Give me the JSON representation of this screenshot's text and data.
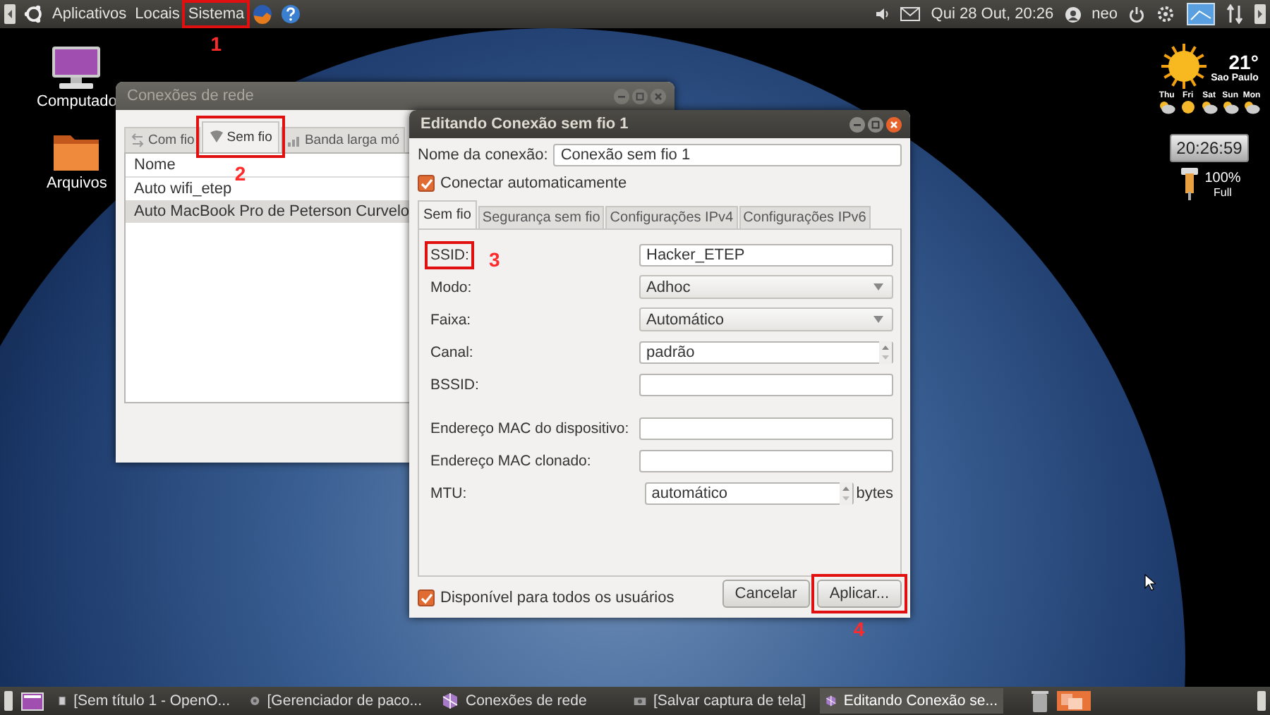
{
  "top_panel": {
    "menus": [
      {
        "label": "Aplicativos"
      },
      {
        "label": "Locais"
      },
      {
        "label": "Sistema"
      }
    ],
    "clock": "Qui 28 Out, 20:26",
    "user": "neo"
  },
  "desktop_icons": [
    {
      "kind": "computer",
      "label": "Computado"
    },
    {
      "kind": "folder",
      "label": "Arquivos"
    }
  ],
  "weather_widget": {
    "temperature": "21°",
    "city": "Sao Paulo",
    "days": [
      "Thu",
      "Fri",
      "Sat",
      "Sun",
      "Mon"
    ],
    "clock": "20:26:59",
    "battery": "100%",
    "battery_state": "Full"
  },
  "network_window": {
    "title": "Conexões de rede",
    "tabs": [
      {
        "label": "Com fio",
        "selected": false
      },
      {
        "label": "Sem fio",
        "selected": true
      },
      {
        "label": "Banda larga mó",
        "selected": false
      }
    ],
    "column": "Nome",
    "rows": [
      {
        "name": "Auto wifi_etep",
        "selected": false
      },
      {
        "name": "Auto MacBook Pro de Peterson Curvelo",
        "selected": true
      }
    ]
  },
  "edit_dialog": {
    "title": "Editando Conexão sem fio 1",
    "name_label": "Nome da conexão:",
    "name_value": "Conexão sem fio 1",
    "auto_connect": {
      "label": "Conectar automaticamente",
      "checked": true
    },
    "tabs": [
      {
        "label": "Sem fio",
        "selected": true
      },
      {
        "label": "Segurança sem fio",
        "selected": false
      },
      {
        "label": "Configurações IPv4",
        "selected": false
      },
      {
        "label": "Configurações IPv6",
        "selected": false
      }
    ],
    "fields": [
      {
        "label": "SSID:",
        "kind": "text",
        "value": "Hacker_ETEP"
      },
      {
        "label": "Modo:",
        "kind": "combo",
        "value": "Adhoc"
      },
      {
        "label": "Faixa:",
        "kind": "combo",
        "value": "Automático"
      },
      {
        "label": "Canal:",
        "kind": "spin",
        "value": "padrão"
      },
      {
        "label": "BSSID:",
        "kind": "text"
      },
      {
        "label": "Endereço MAC do dispositivo:",
        "kind": "text",
        "gap_before": true
      },
      {
        "label": "Endereço MAC clonado:",
        "kind": "text"
      },
      {
        "label": "MTU:",
        "kind": "spin",
        "value": "automático",
        "unit": "bytes"
      }
    ],
    "all_users": {
      "label": "Disponível para todos os usuários",
      "checked": true
    },
    "buttons": [
      {
        "label": "Cancelar"
      },
      {
        "label": "Aplicar..."
      }
    ]
  },
  "annotations": [
    {
      "label": "1"
    },
    {
      "label": "2"
    },
    {
      "label": "3"
    },
    {
      "label": "4"
    }
  ],
  "taskbar": {
    "items": [
      {
        "label": "[Sem título 1 - OpenO...",
        "kind": "document",
        "selected": false
      },
      {
        "label": "[Gerenciador de paco...",
        "kind": "package",
        "selected": false
      },
      {
        "label": "Conexões de rede",
        "kind": "network",
        "selected": false
      },
      {
        "label": "[Salvar captura de tela]",
        "kind": "camera",
        "selected": false
      },
      {
        "label": "Editando Conexão se...",
        "kind": "network",
        "selected": true
      }
    ]
  }
}
